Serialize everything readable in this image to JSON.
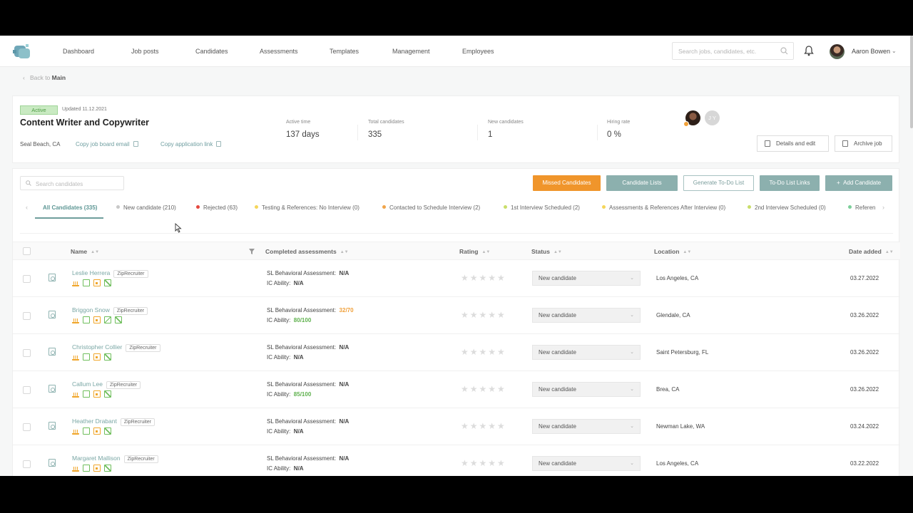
{
  "nav": {
    "links": [
      "Dashboard",
      "Job posts",
      "Candidates",
      "Assessments",
      "Templates",
      "Management",
      "Employees"
    ],
    "search_placeholder": "Search jobs, candidates, etc.",
    "user_name": "Aaron Bowen"
  },
  "back": {
    "prefix": "Back to",
    "target": "Main"
  },
  "job": {
    "status": "Active",
    "updated": "Updated 11.12.2021",
    "title": "Content Writer and Copywriter",
    "location": "Seal Beach, CA",
    "copy_board_email": "Copy job board email",
    "copy_app_link": "Copy application link",
    "stats": [
      {
        "label": "Active time",
        "value": "137 days"
      },
      {
        "label": "Total candidates",
        "value": "335"
      },
      {
        "label": "New candidates",
        "value": "1"
      },
      {
        "label": "Hiring rate",
        "value": "0 %"
      }
    ],
    "team_initials": "J Y",
    "details_btn": "Details and edit",
    "archive_btn": "Archive job"
  },
  "candidates_panel": {
    "search_placeholder": "Search candidates",
    "buttons": {
      "missed": "Missed Candidates",
      "lists": "Candidate Lists",
      "generate": "Generate To-Do List",
      "todo_links": "To-Do List Links",
      "add": "Add Candidate"
    },
    "tabs": [
      {
        "label": "All Candidates (335)",
        "color": ""
      },
      {
        "label": "New candidate (210)",
        "color": "#c8c8c8"
      },
      {
        "label": "Rejected (63)",
        "color": "#e5483f"
      },
      {
        "label": "Testing & References: No Interview (0)",
        "color": "#f5d65a"
      },
      {
        "label": "Contacted to Schedule Interview (2)",
        "color": "#f0a44a"
      },
      {
        "label": "1st Interview Scheduled (2)",
        "color": "#c9de6a"
      },
      {
        "label": "Assessments & References After Interview (0)",
        "color": "#f5d65a"
      },
      {
        "label": "2nd Interview Scheduled (0)",
        "color": "#c9de6a"
      },
      {
        "label": "Referen",
        "color": "#7ccf9a"
      }
    ]
  },
  "table": {
    "headers": {
      "name": "Name",
      "assessments": "Completed assessments",
      "rating": "Rating",
      "status": "Status",
      "location": "Location",
      "date": "Date added"
    },
    "labels": {
      "sl": "SL Behavioral Assessment:",
      "ic": "IC Ability:"
    },
    "rows": [
      {
        "name": "Leslie Herrera",
        "source": "ZipRecruiter",
        "sl": "N/A",
        "ic": "N/A",
        "status": "New candidate",
        "location": "Los Angeles, CA",
        "date": "03.27.2022"
      },
      {
        "name": "Briggon Snow",
        "source": "ZipRecruiter",
        "sl": "32/70",
        "ic": "80/100",
        "status": "New candidate",
        "location": "Glendale, CA",
        "date": "03.26.2022"
      },
      {
        "name": "Christopher Collier",
        "source": "ZipRecruiter",
        "sl": "N/A",
        "ic": "N/A",
        "status": "New candidate",
        "location": "Saint Petersburg, FL",
        "date": "03.26.2022"
      },
      {
        "name": "Callum Lee",
        "source": "ZipRecruiter",
        "sl": "N/A",
        "ic": "85/100",
        "status": "New candidate",
        "location": "Brea, CA",
        "date": "03.26.2022"
      },
      {
        "name": "Heather Drabant",
        "source": "ZipRecruiter",
        "sl": "N/A",
        "ic": "N/A",
        "status": "New candidate",
        "location": "Newman Lake, WA",
        "date": "03.24.2022"
      },
      {
        "name": "Margaret Mallison",
        "source": "ZipRecruiter",
        "sl": "N/A",
        "ic": "N/A",
        "status": "New candidate",
        "location": "Los Angeles, CA",
        "date": "03.22.2022"
      }
    ]
  },
  "colors": {
    "accent": "#6f9e9c",
    "orange": "#f0952b",
    "active_green": "#4f9d45"
  }
}
